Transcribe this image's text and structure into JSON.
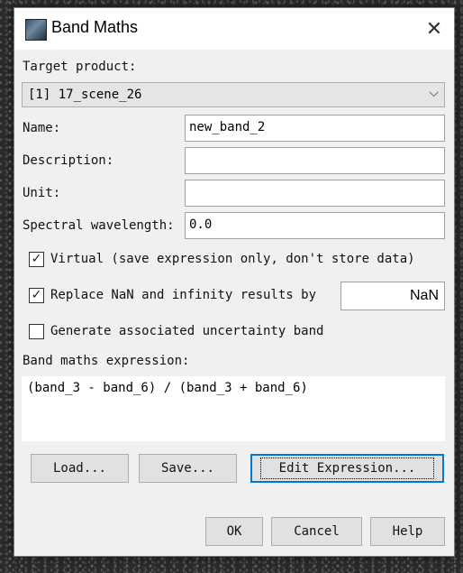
{
  "window": {
    "title": "Band Maths",
    "close_symbol": "✕"
  },
  "target_product": {
    "label": "Target product:",
    "value": "[1] 17_scene_26",
    "arrow": "⌵"
  },
  "fields": {
    "name_label": "Name:",
    "name_value": "new_band_2",
    "description_label": "Description:",
    "description_value": "",
    "unit_label": "Unit:",
    "unit_value": "",
    "wavelength_label": "Spectral wavelength:",
    "wavelength_value": "0.0"
  },
  "options": {
    "virtual": {
      "label": "Virtual (save expression only, don't store data)",
      "checked": "✓"
    },
    "replace_nan": {
      "label": "Replace NaN and infinity results by",
      "checked": "✓",
      "value": "NaN"
    },
    "uncertainty": {
      "label": "Generate associated uncertainty band",
      "checked": ""
    }
  },
  "expression": {
    "label": "Band maths expression:",
    "value": "(band_3 - band_6) /  (band_3 + band_6)"
  },
  "buttons": {
    "load": "Load...",
    "save": "Save...",
    "edit_expression": "Edit Expression...",
    "ok": "OK",
    "cancel": "Cancel",
    "help": "Help"
  }
}
